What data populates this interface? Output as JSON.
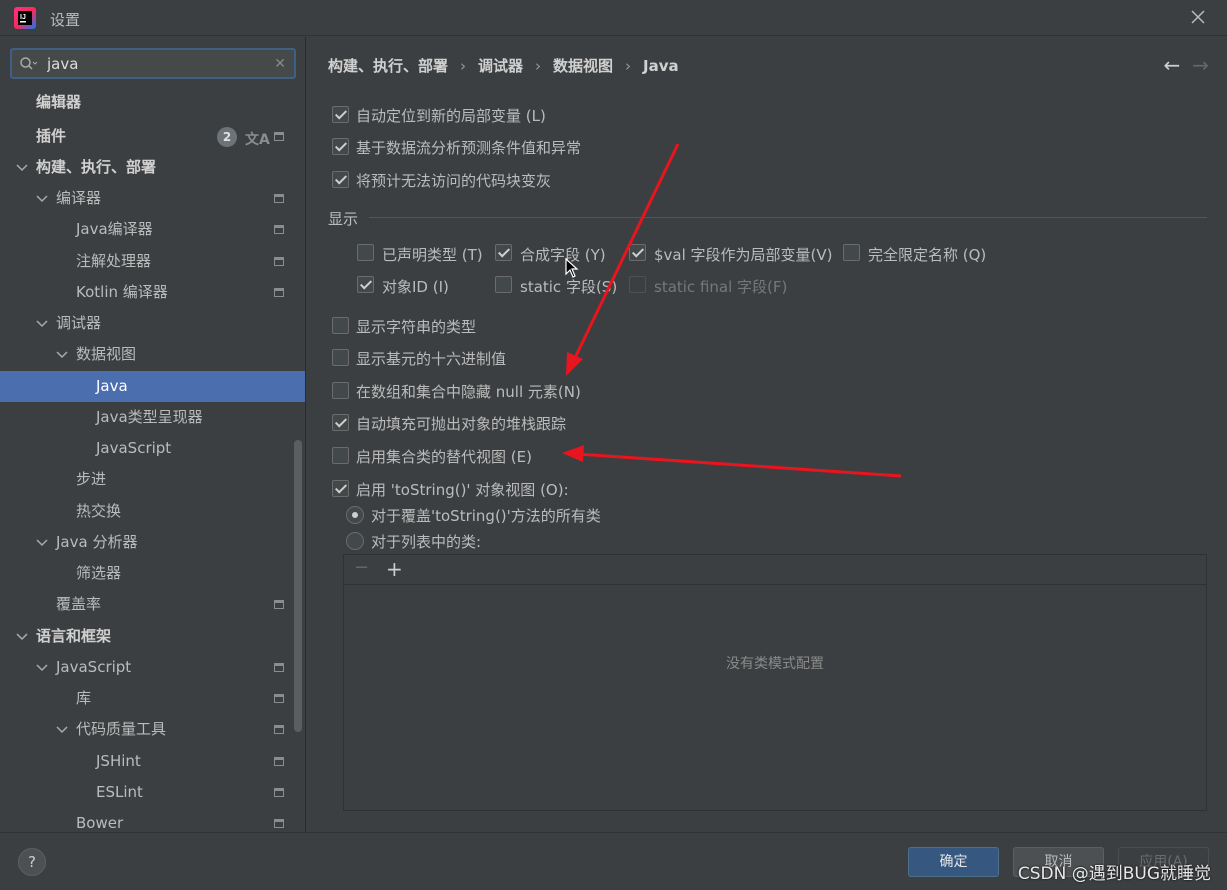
{
  "window": {
    "title": "设置",
    "close_icon": "close-icon",
    "logo_icon": "intellij-logo-icon"
  },
  "search": {
    "value": "java",
    "placeholder": ""
  },
  "sidebar": {
    "badge_count": "2",
    "items": [
      {
        "label": "编辑器"
      },
      {
        "label": "插件"
      },
      {
        "label": "构建、执行、部署"
      },
      {
        "label": "编译器"
      },
      {
        "label": "Java编译器"
      },
      {
        "label": "注解处理器"
      },
      {
        "label": "Kotlin 编译器"
      },
      {
        "label": "调试器"
      },
      {
        "label": "数据视图"
      },
      {
        "label": "Java"
      },
      {
        "label": "Java类型呈现器"
      },
      {
        "label": "JavaScript"
      },
      {
        "label": "步进"
      },
      {
        "label": "热交换"
      },
      {
        "label": "Java 分析器"
      },
      {
        "label": "筛选器"
      },
      {
        "label": "覆盖率"
      },
      {
        "label": "语言和框架"
      },
      {
        "label": "JavaScript"
      },
      {
        "label": "库"
      },
      {
        "label": "代码质量工具"
      },
      {
        "label": "JSHint"
      },
      {
        "label": "ESLint"
      },
      {
        "label": "Bower"
      }
    ]
  },
  "breadcrumb": {
    "items": [
      "构建、执行、部署",
      "调试器",
      "数据视图",
      "Java"
    ],
    "separator": "›"
  },
  "nav": {
    "back": "←",
    "forward": "→"
  },
  "options": {
    "auto_locate": {
      "label": "自动定位到新的局部变量 (L)",
      "checked": true
    },
    "predict": {
      "label": "基于数据流分析预测条件值和异常",
      "checked": true
    },
    "gray_unreachable": {
      "label": "将预计无法访问的代码块变灰",
      "checked": true
    },
    "display_title": "显示",
    "declared_type": {
      "label": "已声明类型 (T)",
      "checked": false
    },
    "synthetic_fields": {
      "label": "合成字段 (Y)",
      "checked": true
    },
    "val_fields": {
      "label": "$val 字段作为局部变量(V)",
      "checked": true
    },
    "fq_names": {
      "label": "完全限定名称 (Q)",
      "checked": false
    },
    "object_id": {
      "label": "对象ID (I)",
      "checked": true
    },
    "static_fields": {
      "label": "static 字段(S)",
      "checked": false
    },
    "static_final_fields": {
      "label": "static final 字段(F)",
      "checked": false,
      "disabled": true
    },
    "string_type": {
      "label": "显示字符串的类型",
      "checked": false
    },
    "hex_values": {
      "label": "显示基元的十六进制值",
      "checked": false
    },
    "hide_nulls": {
      "label": "在数组和集合中隐藏 null 元素(N)",
      "checked": false
    },
    "stack_traces": {
      "label": "自动填充可抛出对象的堆栈跟踪",
      "checked": true
    },
    "alt_views": {
      "label": "启用集合类的替代视图 (E)",
      "checked": false
    },
    "tostring_view": {
      "label": "启用 'toString()' 对象视图 (O):",
      "checked": true
    },
    "all_overriding": {
      "label": "对于覆盖'toString()'方法的所有类",
      "selected": true
    },
    "list_classes": {
      "label": "对于列表中的类:",
      "selected": false
    }
  },
  "class_panel": {
    "minus": "−",
    "plus": "+",
    "empty_text": "没有类模式配置"
  },
  "footer": {
    "help": "?",
    "ok": "确定",
    "cancel": "取消",
    "apply": "应用(A)",
    "watermark": "CSDN @遇到BUG就睡觉"
  },
  "colors": {
    "background": "#3c3f41",
    "selection": "#4b6eaf",
    "primary_button": "#365880",
    "annotation_arrow": "#e8141e"
  }
}
